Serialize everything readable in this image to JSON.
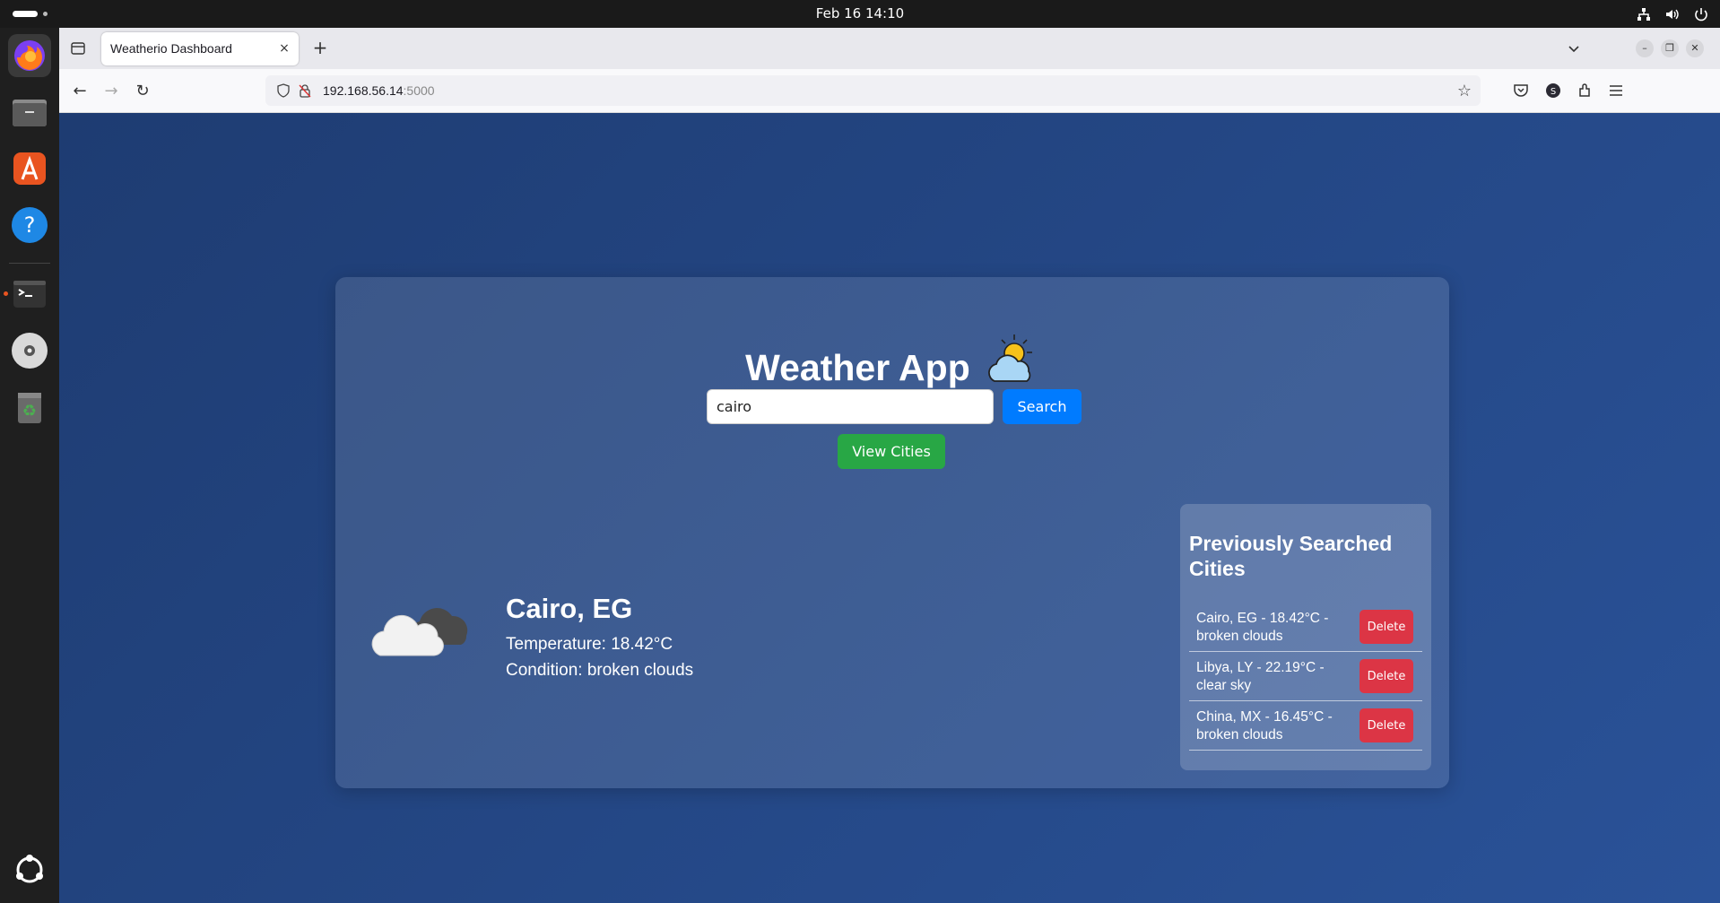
{
  "system": {
    "datetime": "Feb 16  14:10"
  },
  "browser": {
    "tab_title": "Weatherio Dashboard",
    "tab_close": "×",
    "new_tab": "+",
    "url_host": "192.168.56.14",
    "url_port": ":5000",
    "bookmark_icon": "☆"
  },
  "app": {
    "title": "Weather App",
    "search": {
      "value": "cairo",
      "button_label": "Search"
    },
    "view_cities_label": "View Cities",
    "current": {
      "city": "Cairo, EG",
      "temperature": "Temperature: 18.42°C",
      "condition": "Condition: broken clouds",
      "icon": "broken-clouds-icon"
    },
    "history": {
      "heading": "Previously Searched Cities",
      "items": [
        {
          "text": "Cairo, EG - 18.42°C - broken clouds",
          "delete_label": "Delete"
        },
        {
          "text": "Libya, LY - 22.19°C - clear sky",
          "delete_label": "Delete"
        },
        {
          "text": "China, MX - 16.45°C - broken clouds",
          "delete_label": "Delete"
        }
      ]
    }
  },
  "colors": {
    "primary": "#007bff",
    "success": "#28a745",
    "danger": "#dc3545",
    "bg_start": "#1e3c72",
    "bg_end": "#2a5298"
  }
}
